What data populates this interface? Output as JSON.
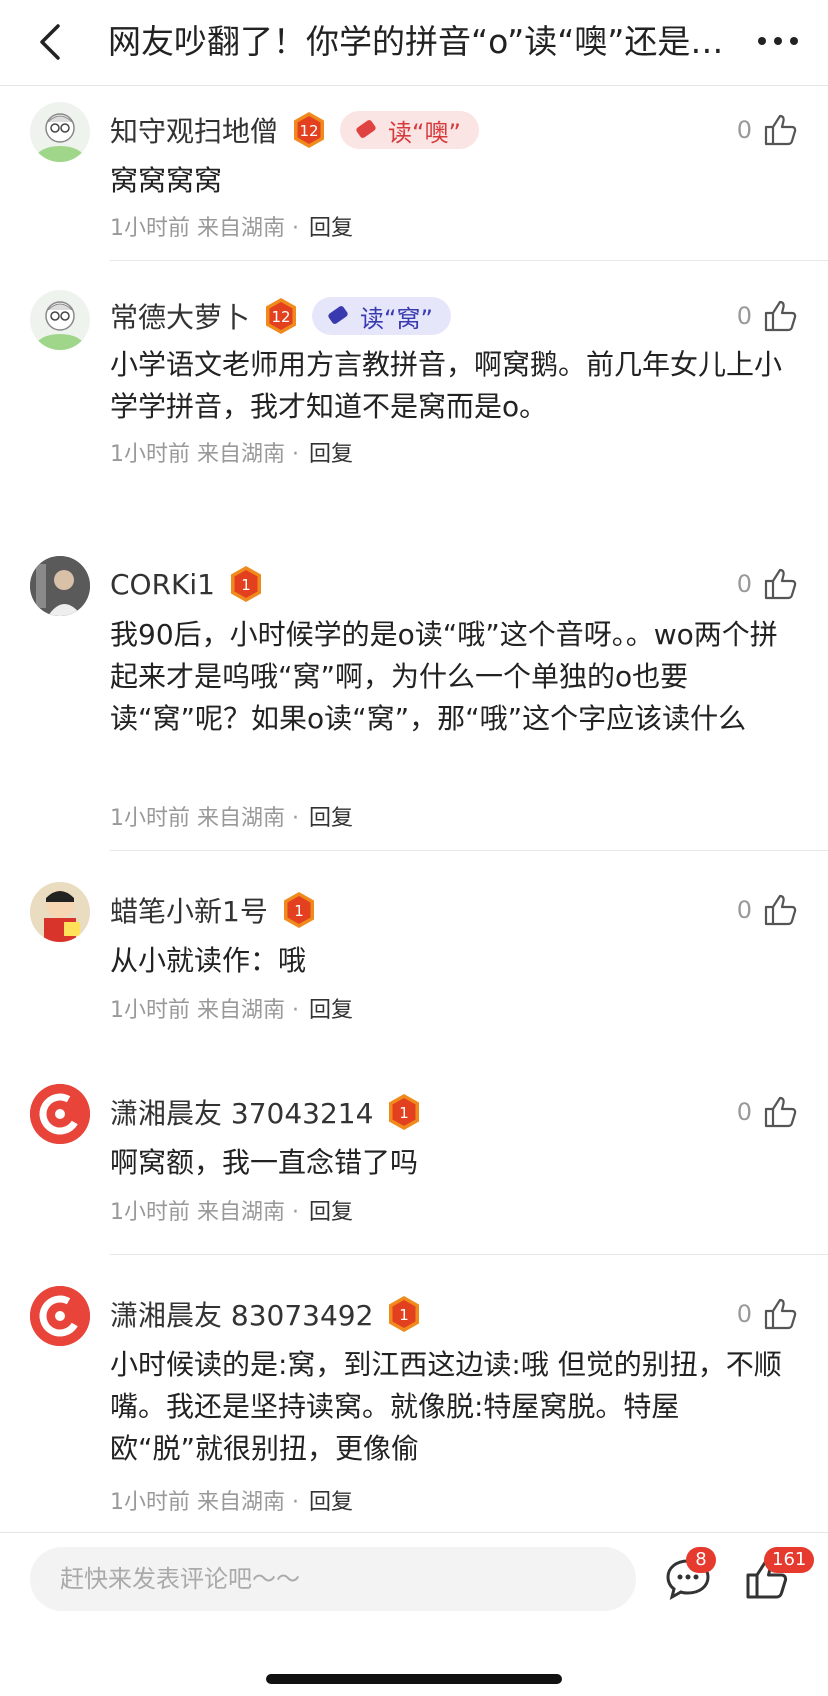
{
  "header": {
    "title": "网友吵翻了！你学的拼音“o”读“噢”还是…",
    "back_icon": "chevron-left-icon",
    "more_icon": "more-dots-icon"
  },
  "comments": [
    {
      "name": "知守观扫地僧",
      "level": "12",
      "tag": "读“噢”",
      "tag_color": "#d63a3a",
      "likes": "0",
      "text": "窝窝窝窝",
      "time": "1小时前 来自湖南 ·",
      "reply": "回复"
    },
    {
      "name": "常德大萝卜",
      "level": "12",
      "tag": "读“窝”",
      "tag_color": "#3a3ab0",
      "likes": "0",
      "text": "小学语文老师用方言教拼音，啊窝鹅。前几年女儿上小学学拼音，我才知道不是窝而是o。",
      "time": "1小时前 来自湖南 ·",
      "reply": "回复"
    },
    {
      "name": "CORKi1",
      "level": "1",
      "likes": "0",
      "text": "我90后，小时候学的是o读“哦”这个音呀。。wo两个拼起来才是呜哦“窝”啊，为什么一个单独的o也要读“窝”呢？如果o读“窝”，那“哦”这个字应该读什么",
      "time": "1小时前 来自湖南 ·",
      "reply": "回复"
    },
    {
      "name": "蜡笔小新1号",
      "level": "1",
      "likes": "0",
      "text": "从小就读作：哦",
      "time": "1小时前 来自湖南 ·",
      "reply": "回复"
    },
    {
      "name": "潇湘晨友 37043214",
      "level": "1",
      "likes": "0",
      "text": "啊窝额，我一直念错了吗",
      "time": "1小时前 来自湖南 ·",
      "reply": "回复"
    },
    {
      "name": "潇湘晨友 83073492",
      "level": "1",
      "likes": "0",
      "text": "小时候读的是:窝，到江西这边读:哦 但觉的别扭，不顺嘴。我还是坚持读窝。就像脱:特屋窝脱。特屋欧“脱”就很别扭，更像偷",
      "time": "1小时前 来自湖南 ·",
      "reply": "回复"
    }
  ],
  "bottom_bar": {
    "placeholder": "赶快来发表评论吧～～",
    "comment_count": "8",
    "like_count": "161",
    "accent": "#e63a2e"
  }
}
